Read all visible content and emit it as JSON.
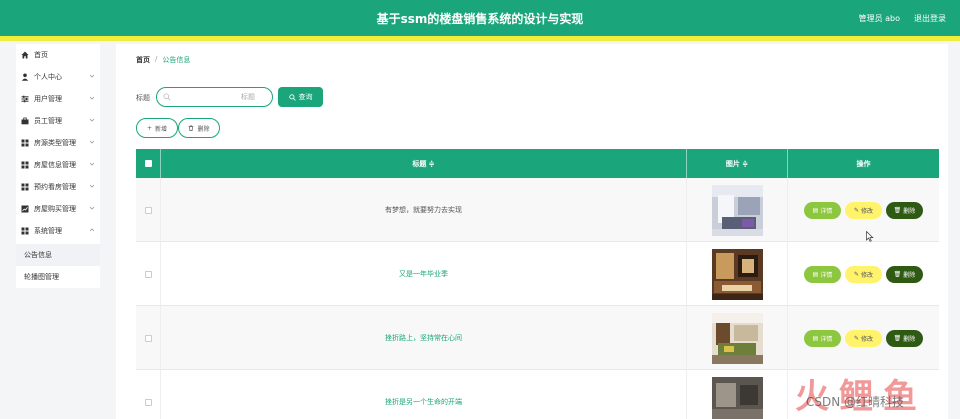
{
  "header": {
    "title": "基于ssm的楼盘销售系统的设计与实现",
    "user_label": "管理员 abo",
    "logout_label": "退出登录"
  },
  "sidebar": {
    "items": [
      {
        "label": "首页",
        "icon": "home-icon"
      },
      {
        "label": "个人中心",
        "icon": "user-icon"
      },
      {
        "label": "用户管理",
        "icon": "sliders-icon"
      },
      {
        "label": "员工管理",
        "icon": "briefcase-icon"
      },
      {
        "label": "房源类型管理",
        "icon": "grid-icon"
      },
      {
        "label": "房屋信息管理",
        "icon": "grid-icon"
      },
      {
        "label": "预约看房管理",
        "icon": "grid-icon"
      },
      {
        "label": "房屋购买管理",
        "icon": "chart-icon"
      },
      {
        "label": "系统管理",
        "icon": "grid-icon"
      }
    ],
    "sub_items": [
      {
        "label": "公告信息"
      },
      {
        "label": "轮播图管理"
      }
    ]
  },
  "breadcrumb": {
    "home": "首页",
    "separator": "/",
    "current": "公告信息"
  },
  "search": {
    "label": "标题",
    "placeholder": "标题",
    "button_label": "查询"
  },
  "actions": {
    "add_label": "新增",
    "delete_label": "删除"
  },
  "table": {
    "columns": {
      "title": "标题 ≑",
      "image": "图片 ≑",
      "ops": "操作"
    },
    "rows": [
      {
        "title": "有梦想，就要努力去实现",
        "title_color": "#555555"
      },
      {
        "title": "又是一年毕业季",
        "title_color": "#1aa57a"
      },
      {
        "title": "挫折路上，坚持常在心间",
        "title_color": "#1aa57a"
      },
      {
        "title": "挫折是另一个生命的开端",
        "title_color": "#1aa57a"
      }
    ],
    "row_ops": {
      "detail": "详情",
      "edit": "修改",
      "delete": "删除"
    }
  },
  "watermark": {
    "text": "CSDN @红晴科技"
  },
  "colors": {
    "primary": "#1aa57a",
    "accent_line": "#f0ee3a",
    "detail": "#8dc63f",
    "edit": "#fff36b",
    "delete": "#2f5a14"
  }
}
